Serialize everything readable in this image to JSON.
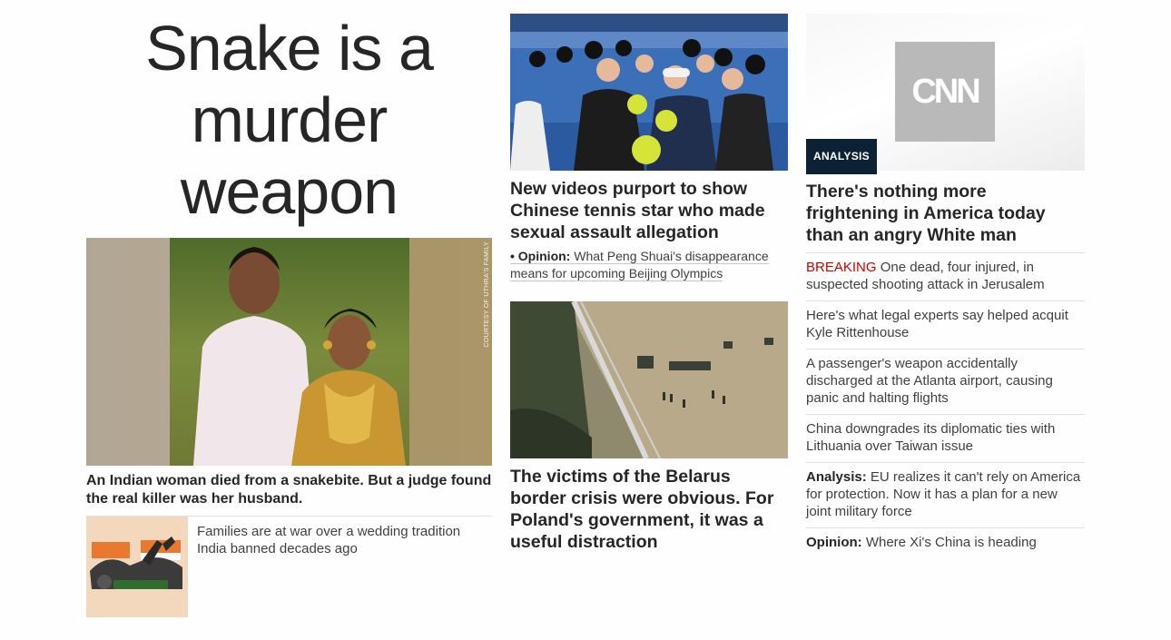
{
  "hero": {
    "title": "Snake is a murder weapon",
    "image_credit": "COURTESY OF UTHRA'S FAMILY",
    "caption": "An Indian woman died from a snakebite. But a judge found the real killer was her husband.",
    "sub_story": "Families are at war over a wedding tradition India banned decades ago"
  },
  "middle": {
    "story1": {
      "headline": "New videos purport to show Chinese tennis star who made sexual assault allegation",
      "opinion_label": "Opinion:",
      "opinion_text": "What Peng Shuai's disappearance means for upcoming Beijing Olympics"
    },
    "story2": {
      "headline": "The victims of the Belarus border crisis were obvious. For Poland's government, it was a useful distraction"
    }
  },
  "right": {
    "logo_text": "CNN",
    "badge": "ANALYSIS",
    "headline": "There's nothing more frightening in America today than an angry White man",
    "list": [
      {
        "prefix": "BREAKING",
        "text": "One dead, four injured, in suspected shooting attack in Jerusalem"
      },
      {
        "prefix": "",
        "text": "Here's what legal experts say helped acquit Kyle Rittenhouse"
      },
      {
        "prefix": "",
        "text": "A passenger's weapon accidentally discharged at the Atlanta airport, causing panic and halting flights"
      },
      {
        "prefix": "",
        "text": "China downgrades its diplomatic ties with Lithuania over Taiwan issue"
      },
      {
        "prefix": "Analysis:",
        "text": "EU realizes it can't rely on America for protection. Now it has a plan for a new joint military force"
      },
      {
        "prefix": "Opinion:",
        "text": "Where Xi's China is heading"
      }
    ]
  },
  "colors": {
    "text": "#262626",
    "breaking": "#cc0000",
    "badge_bg": "#0c2133"
  }
}
